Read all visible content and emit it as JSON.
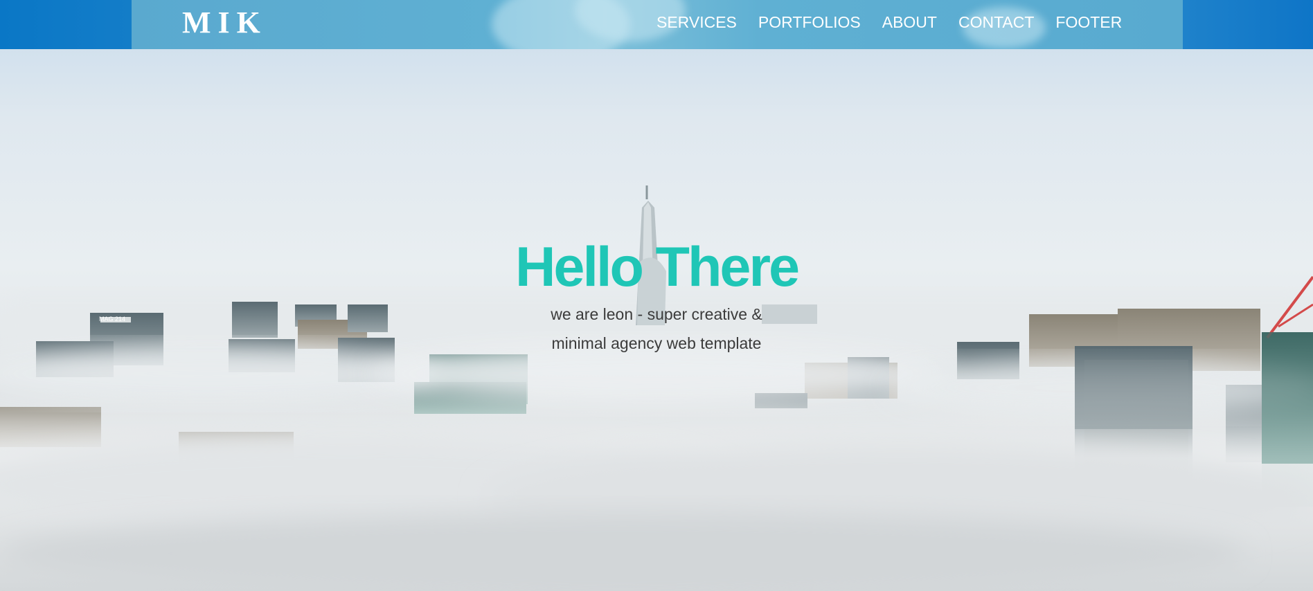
{
  "header": {
    "logo": "MIK",
    "nav": [
      {
        "label": "SERVICES"
      },
      {
        "label": "PORTFOLIOS"
      },
      {
        "label": "ABOUT"
      },
      {
        "label": "CONTACT"
      },
      {
        "label": "FOOTER"
      }
    ]
  },
  "hero": {
    "title": "Hello There",
    "subtitle_line1": "we are leon - super creative &",
    "subtitle_line2": "minimal agency web template",
    "background_image_sign": "MAG 214"
  },
  "colors": {
    "topbar_blue": "#0a77c6",
    "title_teal": "#1fc6b6",
    "subtitle_gray": "#3b3b3b"
  }
}
